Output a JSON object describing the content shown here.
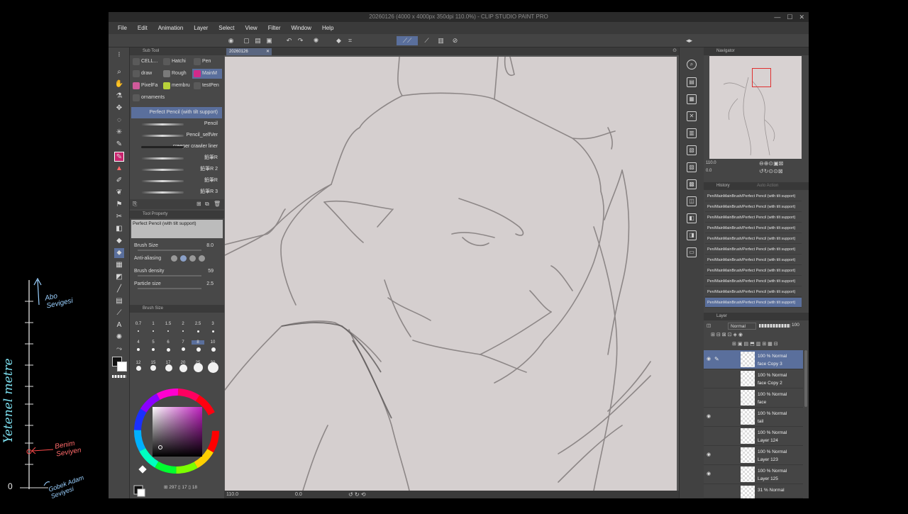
{
  "overlay": {
    "label_vertical": "Yetenel metre",
    "label_top": "Abo Sevigesi",
    "label_mid": "Benim Seviyen",
    "label_bottom": "Gobek Adam Seviyesi",
    "zero": "0"
  },
  "window": {
    "title": "20260126 (4000 x 4000px 350dpi 110.0%) - CLIP STUDIO PAINT PRO"
  },
  "menu": [
    "File",
    "Edit",
    "Animation",
    "Layer",
    "Select",
    "View",
    "Filter",
    "Window",
    "Help"
  ],
  "subtool": {
    "header": "Sub Tool",
    "groups": [
      {
        "label": "CELL...",
        "color": "#5a5a5a"
      },
      {
        "label": "Hatchi",
        "color": "#5a5a5a"
      },
      {
        "label": "Pen",
        "color": "#5a5a5a"
      },
      {
        "label": "draw",
        "color": "#5a5a5a"
      },
      {
        "label": "Rough",
        "color": "#7a7a7a"
      },
      {
        "label": "MainM",
        "color": "#d02a8a"
      },
      {
        "label": "PixelFa",
        "color": "#d05a9a"
      },
      {
        "label": "membru",
        "color": "#b8d23a"
      },
      {
        "label": "testPen",
        "color": "#5a5a5a"
      },
      {
        "label": "ornaments",
        "color": "#5a5a5a"
      }
    ],
    "brushes": [
      "Perfect Pencil (with tilt support)",
      "Pencil",
      "Pencil_selfVer",
      "creeper crawler liner",
      "鉛筆R",
      "鉛筆R 2",
      "鉛筆R",
      "鉛筆R 3"
    ]
  },
  "toolprop": {
    "header": "Tool Property",
    "name": "Perfect Pencil (with tilt support)",
    "brush_size_label": "Brush Size",
    "brush_size": "8.0",
    "antialias_label": "Anti-aliasing",
    "density_label": "Brush density",
    "density": "59",
    "particle_label": "Particle size",
    "particle": "2.5"
  },
  "brushsize": {
    "header": "Brush Size",
    "sizes": [
      "0.7",
      "1",
      "1.5",
      "2",
      "2.5",
      "3",
      "4",
      "5",
      "6",
      "7",
      "8",
      "10",
      "12",
      "15",
      "17",
      "20",
      "25",
      "30"
    ]
  },
  "canvas": {
    "doc_tab": "20260126"
  },
  "status": {
    "zoom": "110.0",
    "rotation": "0.0",
    "coords": "297",
    "coords2": "17",
    "coords3": "18"
  },
  "navigator": {
    "header": "Navigator",
    "zoom": "110.0",
    "angle": "0.0"
  },
  "history": {
    "header": "History",
    "header2": "Auto Action",
    "items": [
      "Pen/MainMainBrush/Perfect Pencil (with tilt support)",
      "Pen/MainMainBrush/Perfect Pencil (with tilt support)",
      "Pen/MainMainBrush/Perfect Pencil (with tilt support)",
      "Pen/MainMainBrush/Perfect Pencil (with tilt support)",
      "Pen/MainMainBrush/Perfect Pencil (with tilt support)",
      "Pen/MainMainBrush/Perfect Pencil (with tilt support)",
      "Pen/MainMainBrush/Perfect Pencil (with tilt support)",
      "Pen/MainMainBrush/Perfect Pencil (with tilt support)",
      "Pen/MainMainBrush/Perfect Pencil (with tilt support)",
      "Pen/MainMainBrush/Perfect Pencil (with tilt support)",
      "Pen/MainMainBrush/Perfect Pencil (with tilt support)"
    ]
  },
  "layers": {
    "header": "Layer",
    "blend": "Normal",
    "opacity": "100",
    "items": [
      {
        "mode": "100 % Normal",
        "name": "face Copy 3",
        "visible": true,
        "selected": true
      },
      {
        "mode": "100 % Normal",
        "name": "face Copy 2",
        "visible": false,
        "selected": false
      },
      {
        "mode": "100 % Normal",
        "name": "face",
        "visible": false,
        "selected": false
      },
      {
        "mode": "100 % Normal",
        "name": "tail",
        "visible": true,
        "selected": false
      },
      {
        "mode": "100 % Normal",
        "name": "Layer 124",
        "visible": false,
        "selected": false
      },
      {
        "mode": "100 % Normal",
        "name": "Layer 123",
        "visible": true,
        "selected": false
      },
      {
        "mode": "100 % Normal",
        "name": "Layer 125",
        "visible": true,
        "selected": false
      },
      {
        "mode": "31 % Normal",
        "name": "",
        "visible": false,
        "selected": false
      }
    ]
  },
  "colors": {
    "accent": "#5a6f9c",
    "main_color": "#c8246e",
    "canvas_bg": "#d5cfcf",
    "line": "#8a8585"
  }
}
